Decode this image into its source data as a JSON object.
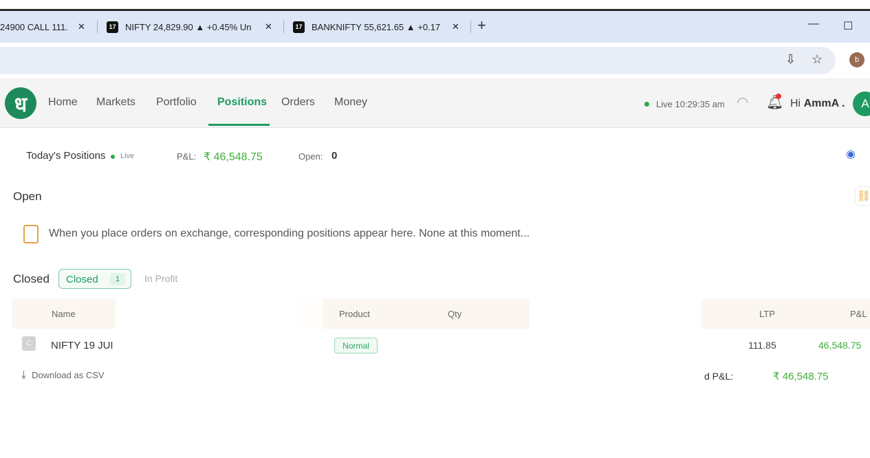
{
  "browser": {
    "tabs": [
      {
        "title": "24900 CALL 111.",
        "favicon": ""
      },
      {
        "title": "NIFTY 24,829.90 ▲ +0.45% Un",
        "favicon": "17"
      },
      {
        "title": "BANKNIFTY 55,621.65 ▲ +0.17",
        "favicon": "17"
      }
    ],
    "profile_initial": "b"
  },
  "app": {
    "logo_glyph": "ध",
    "nav": [
      "Home",
      "Markets",
      "Portfolio",
      "Positions",
      "Orders",
      "Money"
    ],
    "active_nav": "Positions",
    "status": "Live 10:29:35 am",
    "greeting_prefix": "Hi",
    "user_name": "AmmA .",
    "avatar_initial": "A"
  },
  "summary": {
    "title": "Today's Positions",
    "live_label": "Live",
    "pnl_label": "P&L:",
    "pnl_value": "₹ 46,548.75",
    "open_label": "Open:",
    "open_value": "0"
  },
  "open_section": {
    "title": "Open",
    "empty_message": "When you place orders on exchange, corresponding positions appear here. None at this moment..."
  },
  "closed_section": {
    "title": "Closed",
    "chip_label": "Closed",
    "chip_count": "1",
    "chip2_label": "In Profit",
    "columns": {
      "name": "Name",
      "product": "Product",
      "qty": "Qty",
      "ltp": "LTP",
      "pnl": "P&L"
    },
    "rows": [
      {
        "icon": "C",
        "name": "NIFTY 19 JUI",
        "product": "Normal",
        "ltp": "111.85",
        "pnl": "46,548.75"
      }
    ],
    "download_label": "Download as CSV",
    "footer_label": "d P&L:",
    "footer_value": "₹ 46,548.75"
  },
  "colors": {
    "brand": "#1e8a5b",
    "profit": "#3fae3a",
    "tab_bar": "#dce6f6"
  }
}
